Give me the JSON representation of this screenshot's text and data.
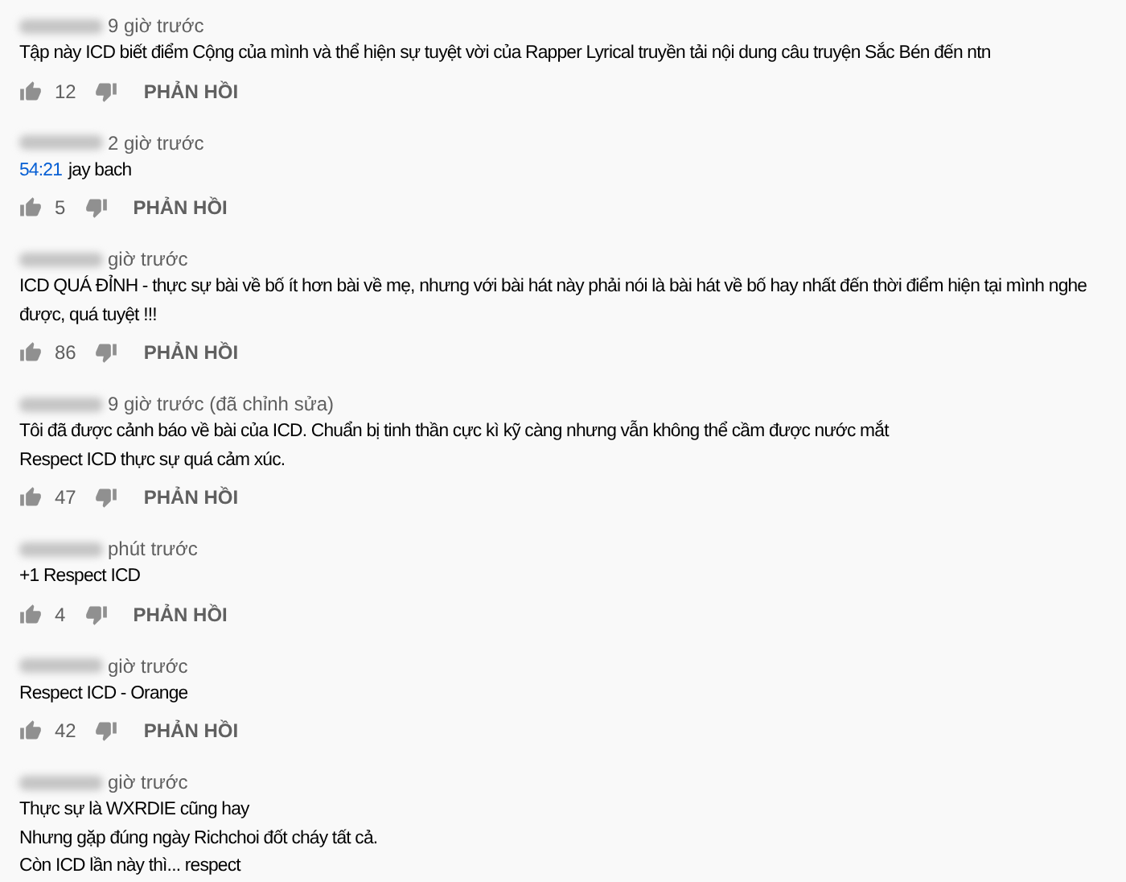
{
  "comments": [
    {
      "time": "9 giờ trước",
      "lines": [
        "Tập này ICD biết điểm Cộng của mình và thể hiện sự tuyệt vời của Rapper Lyrical truyền tải nội dung câu truyện Sắc Bén đến ntn"
      ],
      "likes": "12",
      "reply": "PHẢN HỒI"
    },
    {
      "time": "2 giờ trước",
      "timestamp_link": "54:21",
      "lines": [
        "jay bach"
      ],
      "likes": "5",
      "reply": "PHẢN HỒI"
    },
    {
      "time": "giờ trước",
      "lines": [
        "ICD QUÁ ĐỈNH - thực sự bài về bố ít hơn bài về mẹ, nhưng với bài hát này phải nói là bài hát về bố hay nhất đến thời điểm hiện tại mình nghe",
        "được, quá tuyệt !!!"
      ],
      "likes": "86",
      "reply": "PHẢN HỒI"
    },
    {
      "time": "9 giờ trước (đã chỉnh sửa)",
      "lines": [
        "Tôi đã được cảnh báo về bài của ICD. Chuẩn bị tinh thần cực kì kỹ càng nhưng vẫn không thể cầm được nước mắt",
        "Respect ICD thực sự quá cảm xúc."
      ],
      "likes": "47",
      "reply": "PHẢN HỒI"
    },
    {
      "time": "phút trước",
      "lines": [
        "+1 Respect ICD"
      ],
      "likes": "4",
      "reply": "PHẢN HỒI"
    },
    {
      "time": "giờ trước",
      "lines": [
        "Respect ICD - Orange"
      ],
      "likes": "42",
      "reply": "PHẢN HỒI"
    },
    {
      "time": "giờ trước",
      "lines": [
        "Thực sự là WXRDIE cũng hay",
        "Nhưng gặp đúng ngày Richchoi đốt cháy tất cả.",
        "Còn ICD lần này thì... respect"
      ]
    }
  ]
}
